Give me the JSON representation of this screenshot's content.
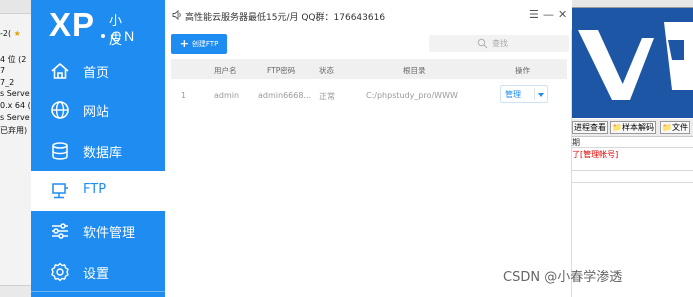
{
  "bg_left": {
    "lines": [
      "-2(",
      "4 位 (2",
      " 7",
      "7_2",
      "s Serve",
      "0.x 64 (",
      "s Serve",
      "已弃用)"
    ]
  },
  "sidebar": {
    "logo": {
      "xp": "XP",
      "cn_top": "小皮",
      "cn_bottom": "CN"
    },
    "items": [
      {
        "label": "首页",
        "icon": "home-icon"
      },
      {
        "label": "网站",
        "icon": "globe-icon"
      },
      {
        "label": "数据库",
        "icon": "database-icon"
      },
      {
        "label": "FTP",
        "icon": "monitor-icon",
        "active": true
      },
      {
        "label": "软件管理",
        "icon": "sliders-icon"
      },
      {
        "label": "设置",
        "icon": "gear-icon"
      }
    ]
  },
  "titlebar": {
    "text": "高性能云服务器最低15元/月  QQ群：176643616",
    "menu": "☰",
    "minimize": "—",
    "close": "✕"
  },
  "toolbar": {
    "create_label": "创建FTP",
    "search_placeholder": "查找"
  },
  "table": {
    "columns": [
      "用户名",
      "FTP密码",
      "状态",
      "根目录",
      "操作"
    ],
    "rows": [
      {
        "index": "1",
        "username": "admin",
        "password": "admin6668...",
        "status": "正常",
        "root": "C:/phpstudy_pro/WWW",
        "action": "管理"
      }
    ]
  },
  "bg_right": {
    "buttons": [
      "进程查看",
      "样本解码",
      "文件"
    ],
    "red_text": "了[管理帐号]",
    "grid_label": "期"
  },
  "watermark": "CSDN @小春学渗透",
  "colors": {
    "accent": "#1e8cf0",
    "sidebar": "#1e8cf0"
  }
}
